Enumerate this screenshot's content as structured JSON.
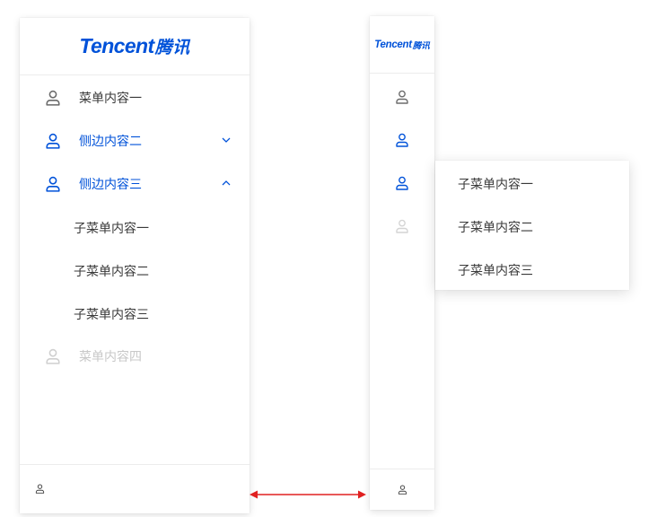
{
  "colors": {
    "brand": "#0052d9",
    "text": "#3a3a3a",
    "icon": "#6b6b6b",
    "disabled": "#c8c8c8",
    "annotation_arrow": "#e02020"
  },
  "expanded_menu": {
    "logo": {
      "text_en": "Tencent",
      "text_cn": "腾讯"
    },
    "items": [
      {
        "label": "菜单内容一",
        "icon": "user-icon",
        "state": "normal"
      },
      {
        "label": "侧边内容二",
        "icon": "user-icon",
        "state": "active",
        "arrow": "chevron-down-icon"
      },
      {
        "label": "侧边内容三",
        "icon": "user-icon",
        "state": "active-open",
        "arrow": "chevron-up-icon"
      },
      {
        "label": "菜单内容四",
        "icon": "user-icon",
        "state": "disabled"
      }
    ],
    "submenu": [
      "子菜单内容一",
      "子菜单内容二",
      "子菜单内容三"
    ],
    "footer": {
      "icon": "user-icon"
    }
  },
  "collapsed_menu": {
    "logo": {
      "text_en": "Tencent",
      "text_cn": "腾讯"
    },
    "items": [
      {
        "icon": "user-icon",
        "state": "normal"
      },
      {
        "icon": "user-icon",
        "state": "active"
      },
      {
        "icon": "user-icon",
        "state": "active"
      },
      {
        "icon": "user-icon",
        "state": "disabled"
      }
    ],
    "popup": [
      "子菜单内容一",
      "子菜单内容二",
      "子菜单内容三"
    ],
    "footer": {
      "icon": "user-icon"
    }
  },
  "annotation": {
    "type": "double-headed-arrow"
  }
}
